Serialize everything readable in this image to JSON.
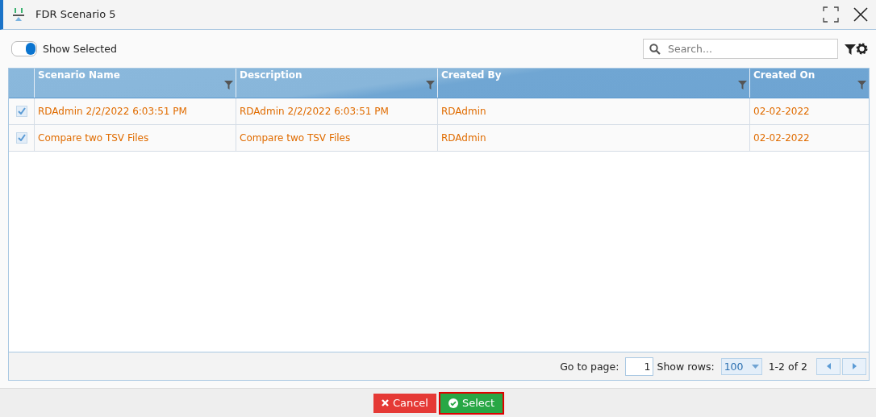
{
  "window": {
    "title": "FDR Scenario 5"
  },
  "toolbar": {
    "show_selected": {
      "label": "Show Selected",
      "on": true
    },
    "search": {
      "placeholder": "Search..."
    }
  },
  "table": {
    "columns": [
      "Scenario Name",
      "Description",
      "Created By",
      "Created On"
    ],
    "rows": [
      {
        "checked": true,
        "cells": [
          "RDAdmin 2/2/2022 6:03:51 PM",
          "RDAdmin 2/2/2022 6:03:51 PM",
          "RDAdmin",
          "02-02-2022"
        ]
      },
      {
        "checked": true,
        "cells": [
          "Compare two TSV Files",
          "Compare two TSV Files",
          "RDAdmin",
          "02-02-2022"
        ]
      }
    ]
  },
  "pager": {
    "goto_label": "Go to page:",
    "page": "1",
    "rows_label": "Show rows:",
    "rows_value": "100",
    "range": "1-2 of 2"
  },
  "buttons": [
    {
      "label": "Cancel",
      "kind": "cancel",
      "focused": false
    },
    {
      "label": "Select",
      "kind": "select",
      "focused": true
    }
  ]
}
